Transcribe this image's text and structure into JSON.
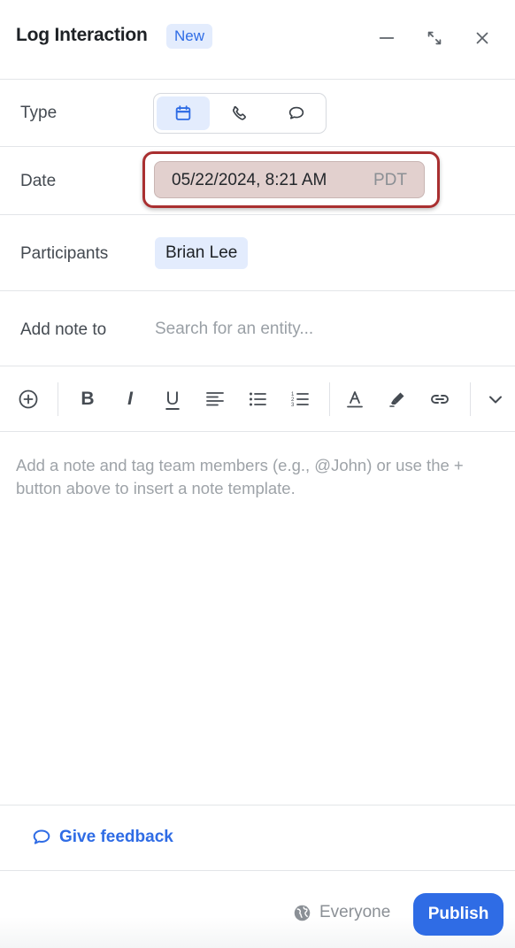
{
  "header": {
    "title": "Log Interaction",
    "badge": "New",
    "icons": [
      "minimize-icon",
      "expand-icon",
      "close-icon"
    ]
  },
  "type_row": {
    "label": "Type",
    "options": [
      {
        "icon": "calendar-icon",
        "selected": true
      },
      {
        "icon": "phone-icon",
        "selected": false
      },
      {
        "icon": "chat-bubble-icon",
        "selected": false
      }
    ]
  },
  "date_row": {
    "label": "Date",
    "value": "05/22/2024, 8:21 AM",
    "timezone": "PDT"
  },
  "participants_row": {
    "label": "Participants",
    "chips": [
      "Brian Lee"
    ]
  },
  "note_row": {
    "label": "Add note to",
    "placeholder": "Search for an entity..."
  },
  "toolbar": {
    "items": [
      "insert-template-icon",
      "bold",
      "italic",
      "underline",
      "align-icon",
      "bullet-list-icon",
      "numbered-list-icon",
      "text-color-icon",
      "highlight-icon",
      "link-icon",
      "more-chevron-icon"
    ],
    "bold_label": "B",
    "italic_label": "I",
    "underline_label": "U"
  },
  "editor": {
    "placeholder": "Add a note and tag team members (e.g., @John) or use the + button above to insert a note template."
  },
  "feedback": {
    "label": "Give feedback"
  },
  "footer": {
    "visibility": "Everyone",
    "publish": "Publish"
  },
  "colors": {
    "accent": "#2f6ce5",
    "badge_bg": "#e3ecfd",
    "highlight_outline": "#a92f30",
    "date_field_bg": "#e2d0ce"
  }
}
